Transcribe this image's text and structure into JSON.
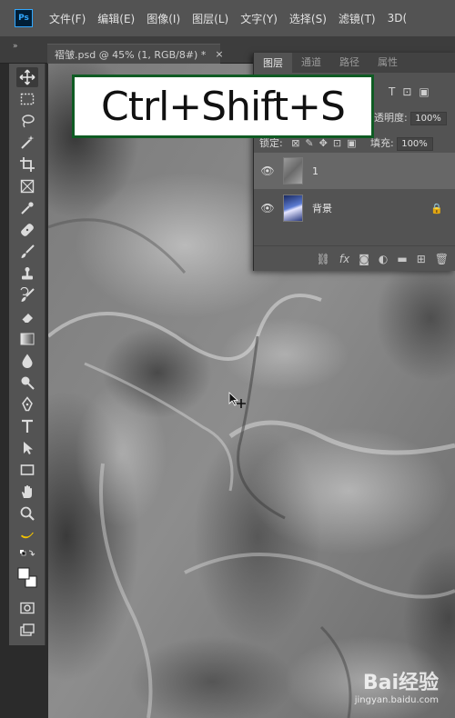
{
  "app": {
    "logo_text": "Ps"
  },
  "menu": [
    "文件(F)",
    "编辑(E)",
    "图像(I)",
    "图层(L)",
    "文字(Y)",
    "选择(S)",
    "滤镜(T)",
    "3D("
  ],
  "document_tab": {
    "title": "褶皱.psd @ 45% (1, RGB/8#) *",
    "close": "×"
  },
  "panel_collapse": "»",
  "layers_panel": {
    "tabs": [
      "图层",
      "通道",
      "路径",
      "属性"
    ],
    "opacity_label": "透明度:",
    "opacity_value": "100%",
    "lock_label": "锁定:",
    "fill_label": "填充:",
    "fill_value": "100%",
    "layers": [
      {
        "name": "1",
        "selected": true
      },
      {
        "name": "背景",
        "locked": true
      }
    ],
    "footer_icons": [
      "link-icon",
      "fx-icon",
      "mask-icon",
      "adjustment-icon",
      "folder-icon",
      "new-layer-icon",
      "trash-icon"
    ],
    "fx_label": "fx"
  },
  "shortcut_overlay": "Ctrl+Shift+S",
  "watermark": {
    "logo": "Bai经验",
    "url": "jingyan.baidu.com"
  },
  "colors": {
    "menubar": "#535353",
    "panel": "#535353",
    "overlay_border": "#0f5b23",
    "ps_blue": "#31a8ff"
  }
}
